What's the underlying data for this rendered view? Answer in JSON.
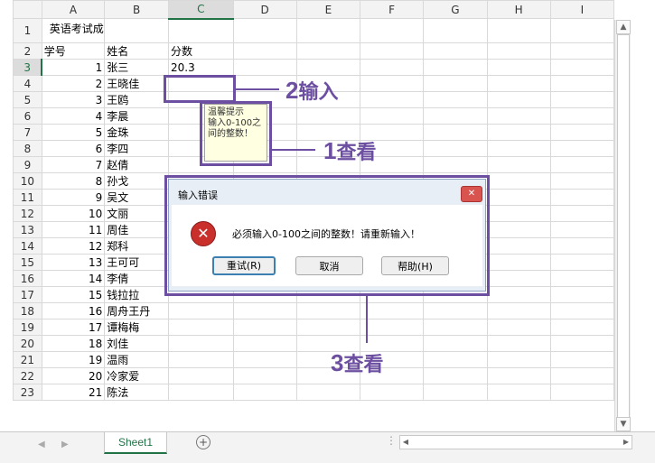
{
  "columns": [
    "",
    "A",
    "B",
    "C",
    "D",
    "E",
    "F",
    "G",
    "H",
    "I"
  ],
  "title": "英语考试成绩表",
  "headers": {
    "a": "学号",
    "b": "姓名",
    "c": "分数"
  },
  "input_value": "20.3",
  "rows": [
    {
      "n": "1"
    },
    {
      "n": "2"
    },
    {
      "n": "3",
      "a": "1",
      "b": "张三"
    },
    {
      "n": "4",
      "a": "2",
      "b": "王晓佳"
    },
    {
      "n": "5",
      "a": "3",
      "b": "王鸥"
    },
    {
      "n": "6",
      "a": "4",
      "b": "李晨"
    },
    {
      "n": "7",
      "a": "5",
      "b": "金珠"
    },
    {
      "n": "8",
      "a": "6",
      "b": "李四"
    },
    {
      "n": "9",
      "a": "7",
      "b": "赵倩"
    },
    {
      "n": "10",
      "a": "8",
      "b": "孙戈"
    },
    {
      "n": "11",
      "a": "9",
      "b": "吴文"
    },
    {
      "n": "12",
      "a": "10",
      "b": "文丽"
    },
    {
      "n": "13",
      "a": "11",
      "b": "周佳"
    },
    {
      "n": "14",
      "a": "12",
      "b": "郑科"
    },
    {
      "n": "15",
      "a": "13",
      "b": "王可可"
    },
    {
      "n": "16",
      "a": "14",
      "b": "李倩"
    },
    {
      "n": "17",
      "a": "15",
      "b": "钱拉拉"
    },
    {
      "n": "18",
      "a": "16",
      "b": "周舟王丹"
    },
    {
      "n": "19",
      "a": "17",
      "b": "谭梅梅"
    },
    {
      "n": "20",
      "a": "18",
      "b": "刘佳"
    },
    {
      "n": "21",
      "a": "19",
      "b": "温雨"
    },
    {
      "n": "22",
      "a": "20",
      "b": "冷家爱"
    },
    {
      "n": "23",
      "a": "21",
      "b": "陈法"
    }
  ],
  "tooltip": {
    "title": "温馨提示",
    "body": "输入0-100之间的整数！"
  },
  "callouts": {
    "one": {
      "num": "1",
      "text": "查看"
    },
    "two": {
      "num": "2",
      "text": "输入"
    },
    "three": {
      "num": "3",
      "text": "查看"
    }
  },
  "dialog": {
    "title": "输入错误",
    "message": "必须输入0-100之间的整数！请重新输入！",
    "close": "✕",
    "retry": "重试(R)",
    "cancel": "取消",
    "help": "帮助(H)"
  },
  "sheet_tab": "Sheet1",
  "add_sheet": "+",
  "accent_color": "#6c4fa0"
}
